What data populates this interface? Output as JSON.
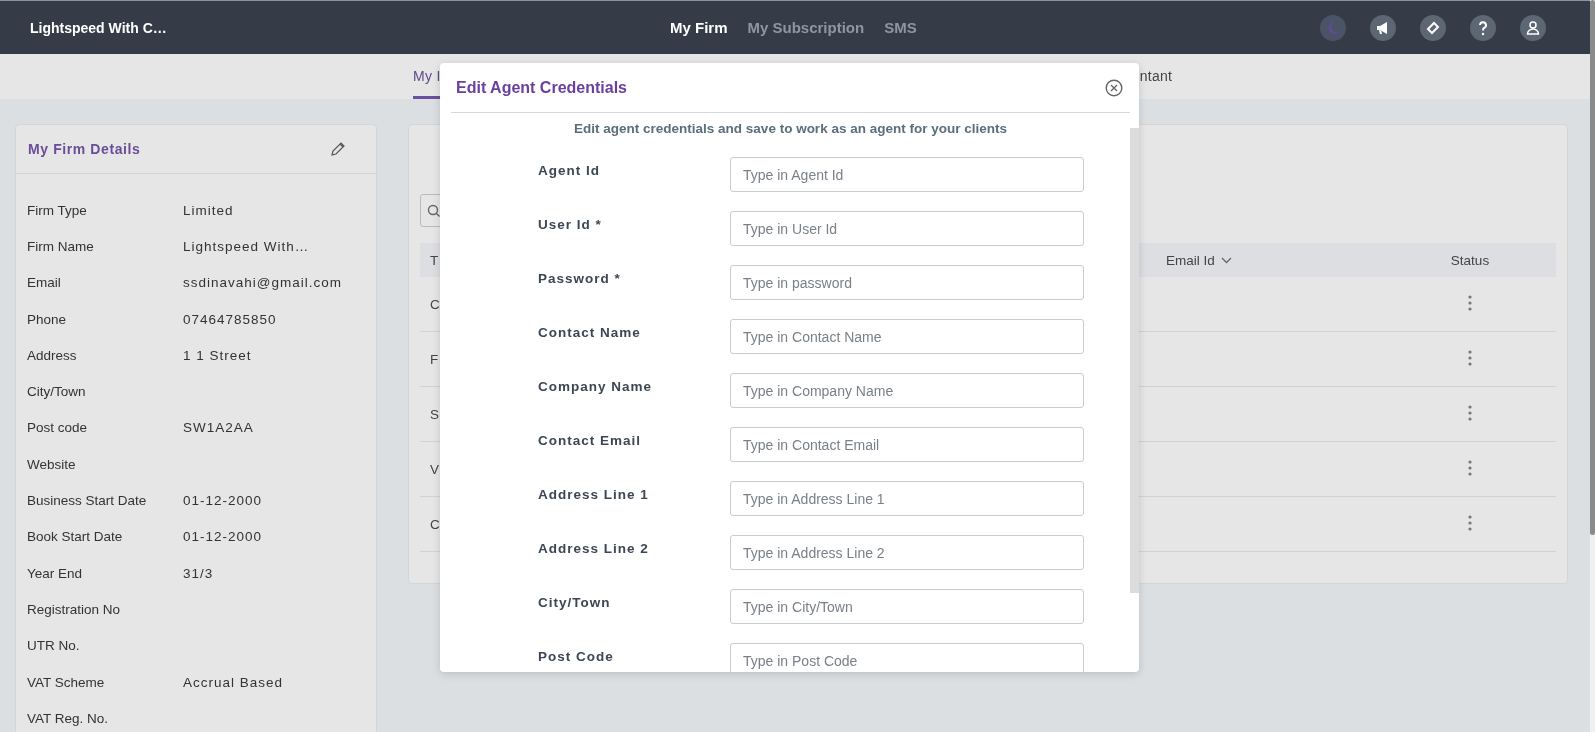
{
  "header": {
    "brand": "Lightspeed With C…",
    "nav": [
      {
        "label": "My Firm",
        "selected": true
      },
      {
        "label": "My Subscription",
        "selected": false
      },
      {
        "label": "SMS",
        "selected": false
      }
    ]
  },
  "tabs": [
    {
      "label": "My I",
      "selected": true
    },
    {
      "label": "ntant",
      "selected": false
    }
  ],
  "firm_details": {
    "title": "My Firm Details",
    "rows": [
      {
        "label": "Firm Type",
        "value": "Limited"
      },
      {
        "label": "Firm Name",
        "value": "Lightspeed With…"
      },
      {
        "label": "Email",
        "value": "ssdinavahi@gmail.com"
      },
      {
        "label": "Phone",
        "value": "07464785850"
      },
      {
        "label": "Address",
        "value": "1 1 Street"
      },
      {
        "label": "City/Town"
      },
      {
        "label": "Post code",
        "value": "SW1A2AA"
      },
      {
        "label": "Website"
      },
      {
        "label": "Business Start Date",
        "value": "01-12-2000"
      },
      {
        "label": "Book Start Date",
        "value": "01-12-2000"
      },
      {
        "label": "Year End",
        "value": "31/3"
      },
      {
        "label": "Registration No"
      },
      {
        "label": "UTR No."
      },
      {
        "label": "VAT Scheme",
        "value": "Accrual Based"
      },
      {
        "label": "VAT Reg. No."
      }
    ]
  },
  "table": {
    "columns": [
      "T",
      "Email Id",
      "Status"
    ],
    "rows": [
      {
        "column_1": "C"
      },
      {
        "column_1": "F"
      },
      {
        "column_1": "S"
      },
      {
        "column_1": "V"
      },
      {
        "column_1": "C"
      }
    ]
  },
  "modal": {
    "title": "Edit Agent Credentials",
    "subtitle": "Edit agent credentials and save to work as an agent for your clients",
    "fields": [
      {
        "label": "Agent Id",
        "placeholder": "Type in Agent Id"
      },
      {
        "label": "User Id *",
        "placeholder": "Type in User Id"
      },
      {
        "label": "Password *",
        "placeholder": "Type in password"
      },
      {
        "label": "Contact Name",
        "placeholder": "Type in Contact Name"
      },
      {
        "label": "Company Name",
        "placeholder": "Type in Company Name"
      },
      {
        "label": "Contact Email",
        "placeholder": "Type in Contact Email"
      },
      {
        "label": "Address Line 1",
        "placeholder": "Type in Address Line 1"
      },
      {
        "label": "Address Line 2",
        "placeholder": "Type in Address Line 2"
      },
      {
        "label": "City/Town",
        "placeholder": "Type in City/Town"
      },
      {
        "label": "Post Code",
        "placeholder": "Type in Post Code"
      }
    ]
  }
}
